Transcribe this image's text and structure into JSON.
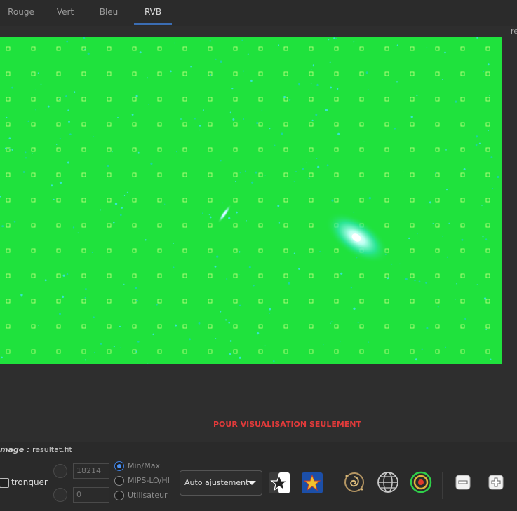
{
  "tabs": [
    {
      "label": "Rouge",
      "active": false
    },
    {
      "label": "Vert",
      "active": false
    },
    {
      "label": "Bleu",
      "active": false
    },
    {
      "label": "RVB",
      "active": true
    }
  ],
  "corner_text": "re",
  "watermark": "POUR VISUALISATION SEULEMENT",
  "image_info": {
    "label": "mage :",
    "filename": "resultat.fit"
  },
  "tronquer": {
    "label": "tronquer",
    "checked": false
  },
  "levels": {
    "high": "18214",
    "low": "0"
  },
  "scale_modes": [
    {
      "label": "Min/Max",
      "selected": true
    },
    {
      "label": "MIPS-LO/HI",
      "selected": false
    },
    {
      "label": "Utilisateur",
      "selected": false
    }
  ],
  "adjust_dropdown": {
    "value": "Auto ajustement"
  },
  "toolbar_icons": [
    "star-outline-icon",
    "star-color-icon",
    "galaxy-icon",
    "globe-icon",
    "target-icon",
    "zoom-out-icon",
    "zoom-in-icon"
  ],
  "colors": {
    "accent": "#3b6db3",
    "viewer_bg": "#1fe23d",
    "watermark": "#e23a3a"
  }
}
